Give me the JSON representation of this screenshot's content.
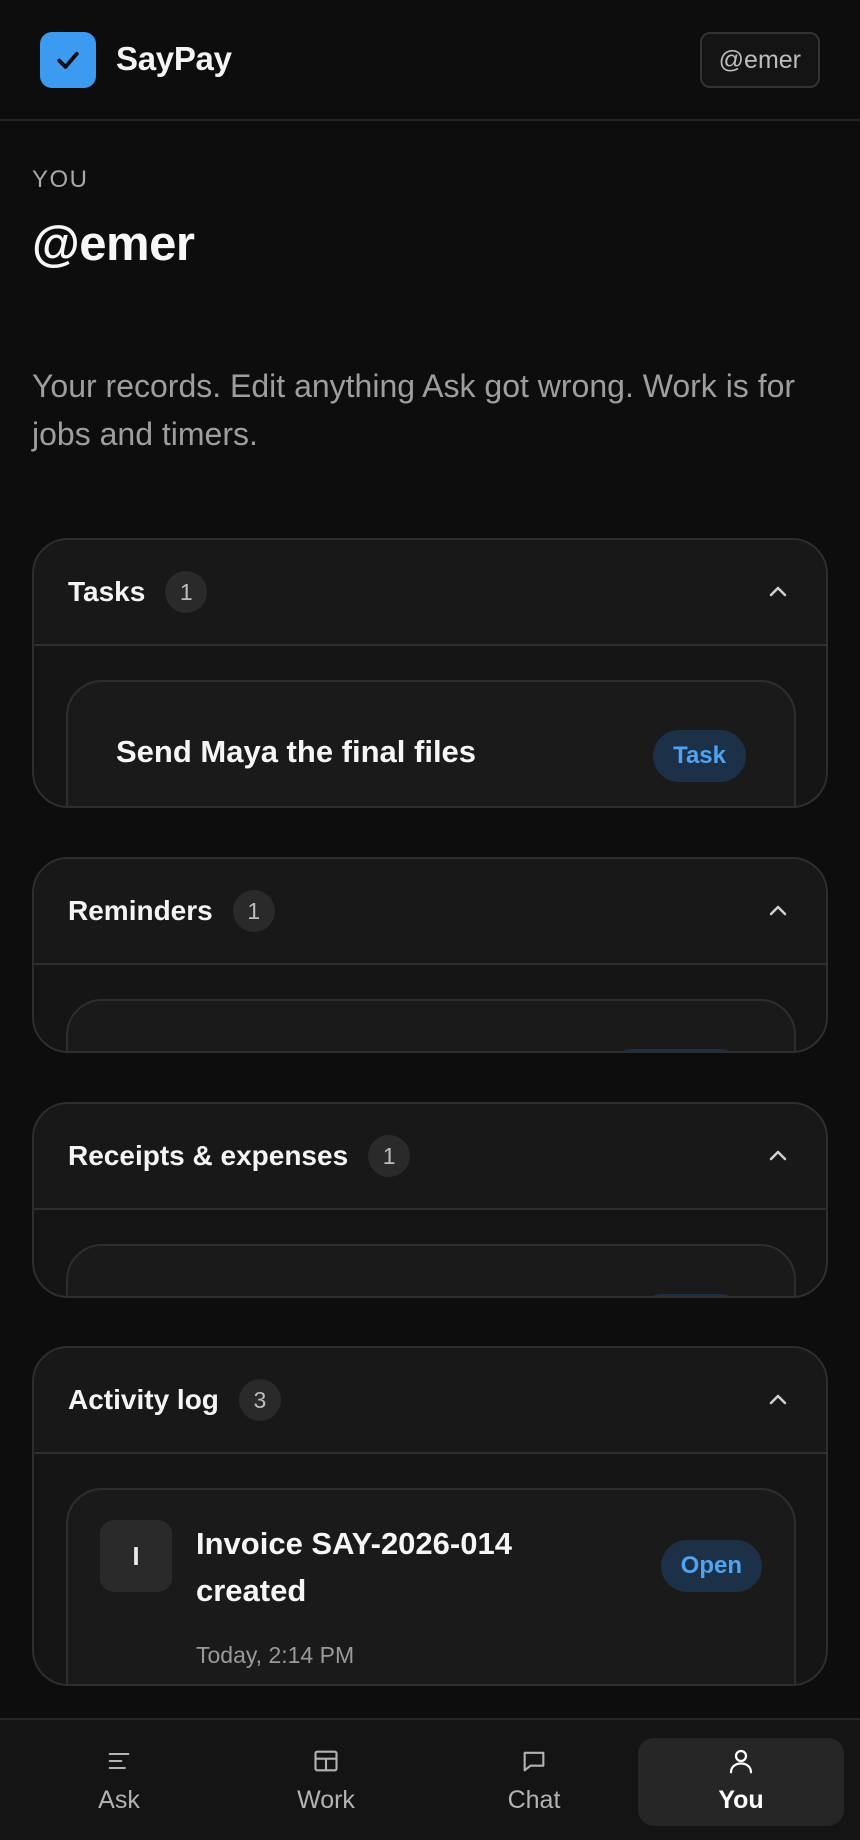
{
  "app": {
    "brand": "SayPay",
    "user_chip": "@emer",
    "accent": "#3c9af0"
  },
  "page": {
    "eyebrow": "YOU",
    "title": "@emer",
    "intro": "Your records. Edit anything Ask got wrong. Work is for jobs and timers."
  },
  "sections": {
    "tasks": {
      "title": "Tasks",
      "count": "1",
      "items": [
        {
          "title": "Send Maya the final files",
          "tag": "Task"
        }
      ]
    },
    "reminders": {
      "title": "Reminders",
      "count": "1"
    },
    "receipts": {
      "title": "Receipts & expenses",
      "count": "1"
    },
    "activity": {
      "title": "Activity log",
      "count": "3",
      "items": [
        {
          "icon_letter": "I",
          "title": "Invoice SAY-2026-014 created",
          "tag": "Open",
          "time": "Today, 2:14 PM"
        }
      ]
    }
  },
  "nav": {
    "items": [
      {
        "label": "Ask",
        "icon": "menu-lines-icon"
      },
      {
        "label": "Work",
        "icon": "layout-icon"
      },
      {
        "label": "Chat",
        "icon": "chat-bubble-icon"
      },
      {
        "label": "You",
        "icon": "person-icon",
        "active": true
      }
    ]
  }
}
